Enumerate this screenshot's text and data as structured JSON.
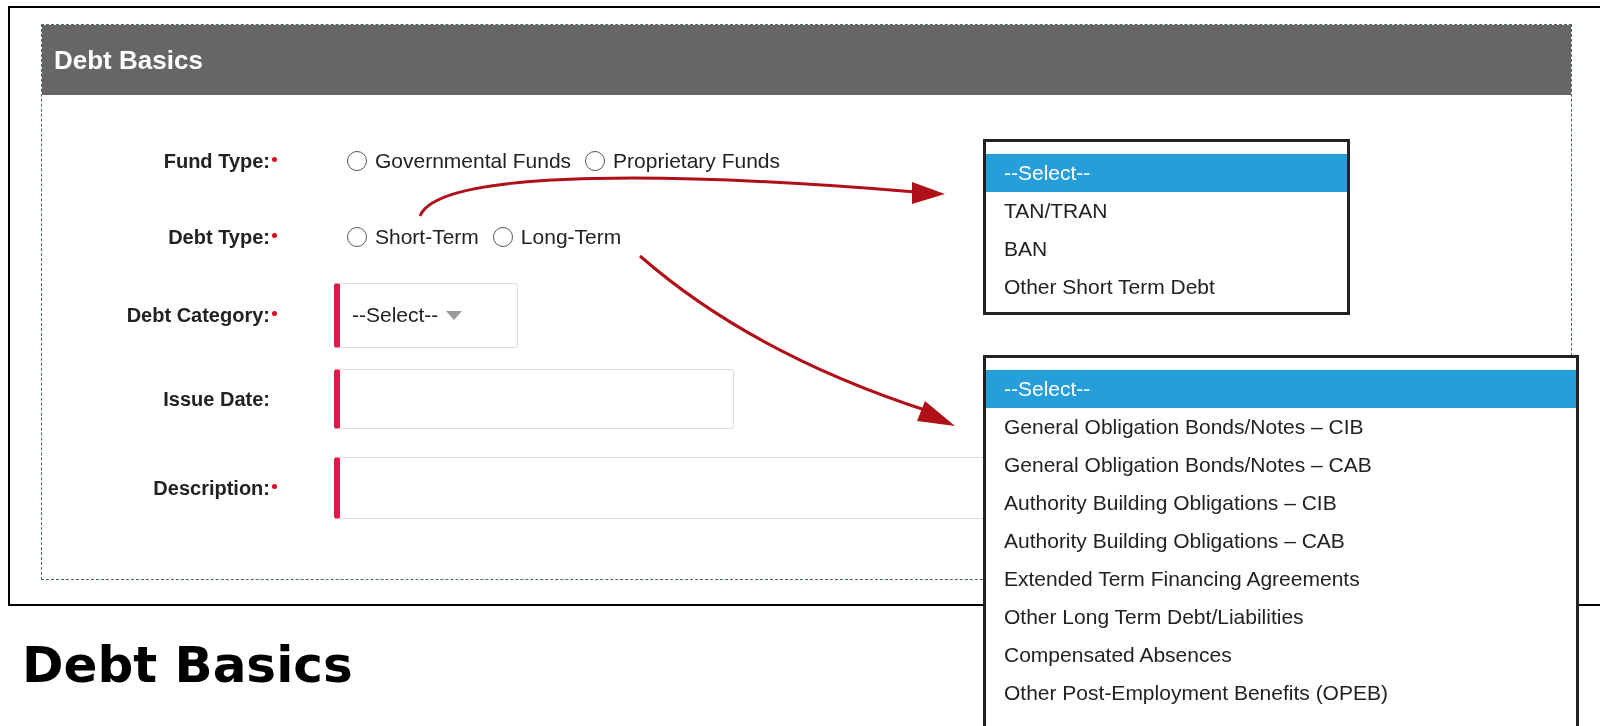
{
  "panel": {
    "title": "Debt Basics"
  },
  "fields": [
    {
      "kind": "radio",
      "label": "Fund Type:",
      "required": true,
      "options": [
        {
          "label": "Governmental Funds",
          "selected": false
        },
        {
          "label": "Proprietary Funds",
          "selected": false
        }
      ]
    },
    {
      "kind": "radio",
      "label": "Debt Type:",
      "required": true,
      "options": [
        {
          "label": "Short-Term",
          "selected": false
        },
        {
          "label": "Long-Term",
          "selected": false
        }
      ]
    },
    {
      "kind": "select",
      "label": "Debt Category:",
      "required": true,
      "value": "--Select--"
    },
    {
      "kind": "date",
      "label": "Issue Date:",
      "required": false
    },
    {
      "kind": "textarea",
      "label": "Description:",
      "required": true
    }
  ],
  "dropdowns": [
    {
      "options": [
        {
          "label": "--Select--",
          "selected": true
        },
        {
          "label": "TAN/TRAN",
          "selected": false
        },
        {
          "label": "BAN",
          "selected": false
        },
        {
          "label": "Other Short Term Debt",
          "selected": false
        }
      ]
    },
    {
      "options": [
        {
          "label": "--Select--",
          "selected": true
        },
        {
          "label": "General Obligation Bonds/Notes – CIB",
          "selected": false
        },
        {
          "label": "General Obligation Bonds/Notes – CAB",
          "selected": false
        },
        {
          "label": "Authority Building Obligations – CIB",
          "selected": false
        },
        {
          "label": "Authority Building Obligations – CAB",
          "selected": false
        },
        {
          "label": "Extended Term Financing Agreements",
          "selected": false
        },
        {
          "label": "Other Long Term Debt/Liabilities",
          "selected": false
        },
        {
          "label": "Compensated Absences",
          "selected": false
        },
        {
          "label": "Other Post-Employment Benefits (OPEB)",
          "selected": false
        }
      ]
    }
  ],
  "heading": "Debt Basics"
}
